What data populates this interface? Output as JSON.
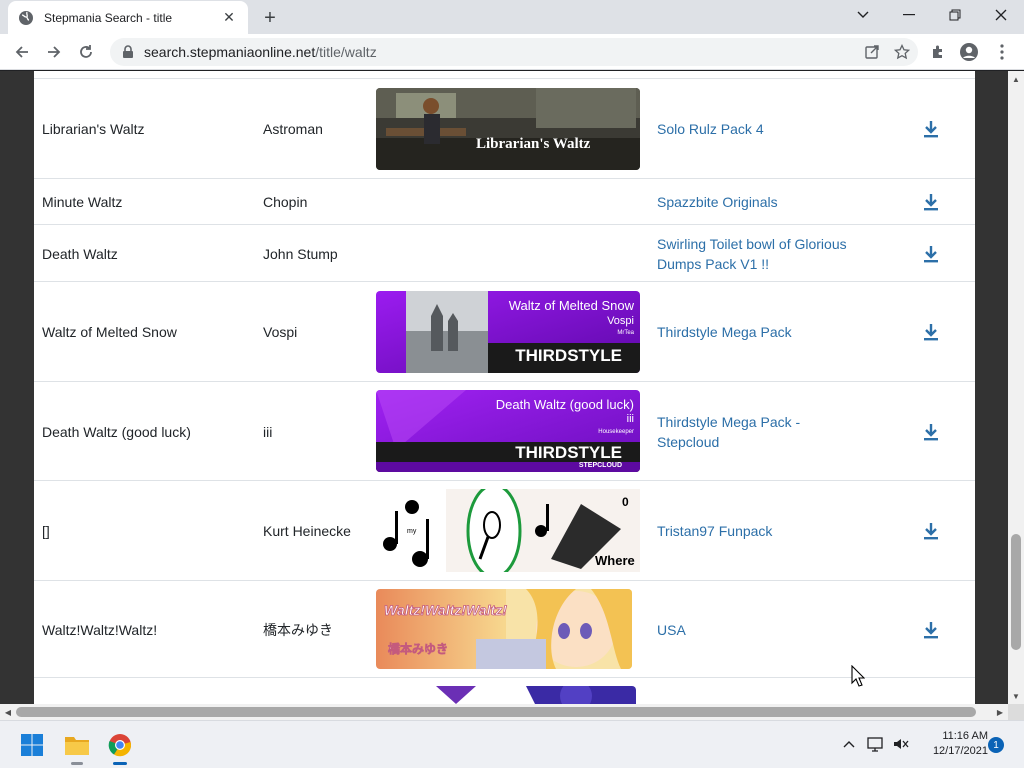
{
  "browser": {
    "tab_title": "Stepmania Search - title",
    "url_host": "search.stepmaniaonline.net",
    "url_path": "/title/waltz"
  },
  "songs": [
    {
      "title": "Librarian's Waltz",
      "artist": "Astroman",
      "pack": "Solo Rulz Pack 4",
      "banner_text": "Librarian's Waltz"
    },
    {
      "title": "Minute Waltz",
      "artist": "Chopin",
      "pack": "Spazzbite Originals"
    },
    {
      "title": "Death Waltz",
      "artist": "John Stump",
      "pack_line1": "Swirling Toilet bowl of Glorious",
      "pack_line2": "Dumps Pack V1 !!"
    },
    {
      "title": "Waltz of Melted Snow",
      "artist": "Vospi",
      "pack": "Thirdstyle Mega Pack",
      "banner_title": "Waltz of Melted Snow",
      "banner_artist": "Vospi",
      "banner_credit": "MrTea",
      "banner_brand": "THIRDSTYLE"
    },
    {
      "title": "Death Waltz (good luck)",
      "artist": "iii",
      "pack": "Thirdstyle Mega Pack - Stepcloud",
      "banner_title": "Death Waltz (good luck)",
      "banner_artist": "iii",
      "banner_credit": "Housekeeper",
      "banner_brand": "THIRDSTYLE",
      "banner_sub": "STEPCLOUD"
    },
    {
      "title": "[]",
      "artist": "Kurt Heinecke",
      "pack": "Tristan97 Funpack",
      "banner_word": "Where",
      "banner_small": "my",
      "banner_zero": "0"
    },
    {
      "title": "Waltz!Waltz!Waltz!",
      "artist": "橋本みゆき",
      "pack": "USA",
      "banner_text": "Waltz!Waltz!Waltz!",
      "banner_sub": "橋本みゆき"
    }
  ],
  "taskbar": {
    "time": "11:16 AM",
    "date": "12/17/2021",
    "notifications": "1"
  },
  "colors": {
    "link": "#2c6fa8",
    "purple_banner": "#7b12d8"
  }
}
